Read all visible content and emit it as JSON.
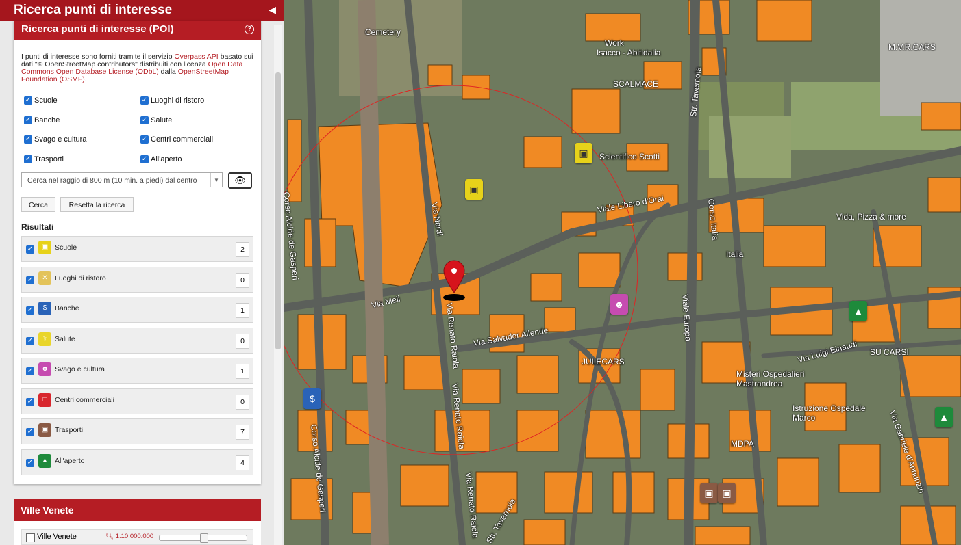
{
  "app": {
    "title": "Ricerca punti di interesse",
    "collapse_icon": "caret-left-icon"
  },
  "poi_panel": {
    "title": "Ricerca punti di interesse (POI)",
    "help_icon": "?",
    "intro": {
      "part1": "I punti di interesse sono forniti tramite il servizio ",
      "link1": "Overpass API",
      "part2": " basato sui dati \"© OpenStreetMap contributors\" distribuiti con licenza ",
      "link2": "Open Data Commons Open Database License (ODbL)",
      "part3": " dalla ",
      "link3": "OpenStreetMap Foundation (OSMF)",
      "part4": "."
    },
    "filters": [
      {
        "label": "Scuole",
        "checked": true
      },
      {
        "label": "Luoghi di ristoro",
        "checked": true
      },
      {
        "label": "Banche",
        "checked": true
      },
      {
        "label": "Salute",
        "checked": true
      },
      {
        "label": "Svago e cultura",
        "checked": true
      },
      {
        "label": "Centri commerciali",
        "checked": true
      },
      {
        "label": "Trasporti",
        "checked": true
      },
      {
        "label": "All'aperto",
        "checked": true
      }
    ],
    "radius_select": {
      "value": "Cerca nel raggio di 800 m (10 min. a piedi) dal centro"
    },
    "eye_button_icon": "eye-slash-icon",
    "search_button": "Cerca",
    "reset_button": "Resetta la ricerca",
    "results_title": "Risultati",
    "results": [
      {
        "label": "Scuole",
        "count": "2",
        "icon": "school-icon",
        "color": "#e7d21a"
      },
      {
        "label": "Luoghi di ristoro",
        "count": "0",
        "icon": "restaurant-icon",
        "color": "#e3c35a"
      },
      {
        "label": "Banche",
        "count": "1",
        "icon": "bank-icon",
        "color": "#2a63b8"
      },
      {
        "label": "Salute",
        "count": "0",
        "icon": "health-icon",
        "color": "#e9d52a"
      },
      {
        "label": "Svago e cultura",
        "count": "1",
        "icon": "theatre-icon",
        "color": "#c64cb0"
      },
      {
        "label": "Centri commerciali",
        "count": "0",
        "icon": "shopping-icon",
        "color": "#d8262d"
      },
      {
        "label": "Trasporti",
        "count": "7",
        "icon": "bus-icon",
        "color": "#8a5a44"
      },
      {
        "label": "All'aperto",
        "count": "4",
        "icon": "tree-icon",
        "color": "#1e8a3b"
      }
    ]
  },
  "ville_panel": {
    "title": "Ville Venete",
    "layer_label": "Ville Venete",
    "layer_checked": false,
    "scale_label": "1:10.000.000",
    "opacity": 0.5
  },
  "map": {
    "search_radius_m": 800,
    "labels": {
      "cemetery": "Cemetery",
      "work": "Work",
      "isacco": "Isacco - Abitidalia",
      "scalmace": "SCALMACE",
      "mv_cars": "M.V.R.CARS",
      "scientifico": "Scientifico Scotti",
      "via_nardi": "Via Nardi",
      "viale_libero": "Viale Libero d'Orai",
      "str_tavernola": "Str. Tavernola",
      "corso_italia": "Corso Italia",
      "italia": "Italia",
      "vida": "Vida, Pizza & more",
      "corso_alcide_top": "Corso Alcide de Gasperi",
      "corso_alcide_bottom": "Corso Alcide de Gasperi",
      "via_meli": "Via Meli",
      "via_raiola_top": "Via Renato Raiola",
      "via_allende": "Via Salvador Allende",
      "viale_europa": "Viale Europa",
      "julecars": "JULECARS",
      "via_einaudi": "Via Luigi Einaudi",
      "su_carsi": "SU CARSI",
      "misteri": "Misteri Ospedalieri Mastrandrea",
      "istruzione": "Istruzione Ospedale Marco",
      "via_raiola_1": "Via Renato Raiola",
      "via_raiola_2": "Via Renato Raiola",
      "str_tavernola_b": "Str. Tavernola",
      "via_gabriele": "Via Gabriele d'Annunzio",
      "mdpa": "MDPA"
    }
  }
}
